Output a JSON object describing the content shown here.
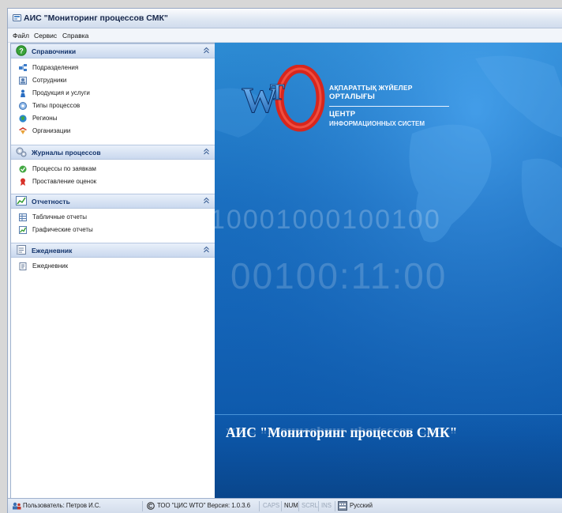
{
  "window": {
    "title": "АИС \"Мониторинг процессов СМК\""
  },
  "menu": [
    "Файл",
    "Сервис",
    "Справка"
  ],
  "sidebar": {
    "groups": [
      {
        "title": "Справочники",
        "icon": "help-icon",
        "items": [
          {
            "label": "Подразделения",
            "icon": "departments-icon"
          },
          {
            "label": "Сотрудники",
            "icon": "employees-icon"
          },
          {
            "label": "Продукция и услуги",
            "icon": "products-icon"
          },
          {
            "label": "Типы процессов",
            "icon": "process-types-icon"
          },
          {
            "label": "Регионы",
            "icon": "globe-icon"
          },
          {
            "label": "Организации",
            "icon": "organizations-icon"
          }
        ]
      },
      {
        "title": "Журналы процессов",
        "icon": "gears-icon",
        "items": [
          {
            "label": "Процессы по заявкам",
            "icon": "process-requests-icon"
          },
          {
            "label": "Проставление оценок",
            "icon": "ribbon-icon"
          }
        ]
      },
      {
        "title": "Отчетность",
        "icon": "chart-icon",
        "items": [
          {
            "label": "Табличные отчеты",
            "icon": "table-report-icon"
          },
          {
            "label": "Графические отчеты",
            "icon": "graph-report-icon"
          }
        ]
      },
      {
        "title": "Ежедневник",
        "icon": "notebook-icon",
        "items": [
          {
            "label": "Ежедневник",
            "icon": "diary-icon"
          }
        ]
      }
    ]
  },
  "banner": {
    "logo_text": "WTO",
    "org_lines": [
      "АҚПАРАТТЫҚ ЖҮЙЕЛЕР",
      "ОРТАЛЫҒЫ",
      "ЦЕНТР",
      "ИНФОРМАЦИОННЫХ СИСТЕМ"
    ],
    "binary_1": "10001000100100",
    "binary_2": "00100:11:00",
    "title": "АИС \"Мониторинг процессов СМК\""
  },
  "status": {
    "user": "Пользователь: Петров И.С.",
    "copyright": "ТОО \"ЦИС WTO\" Версия: 1.0.3.6",
    "caps": "CAPS",
    "num": "NUM",
    "scrl": "SCRL",
    "ins": "INS",
    "language": "Русский"
  },
  "colors": {
    "accent": "#1a6fc0",
    "header_text": "#12336b"
  }
}
